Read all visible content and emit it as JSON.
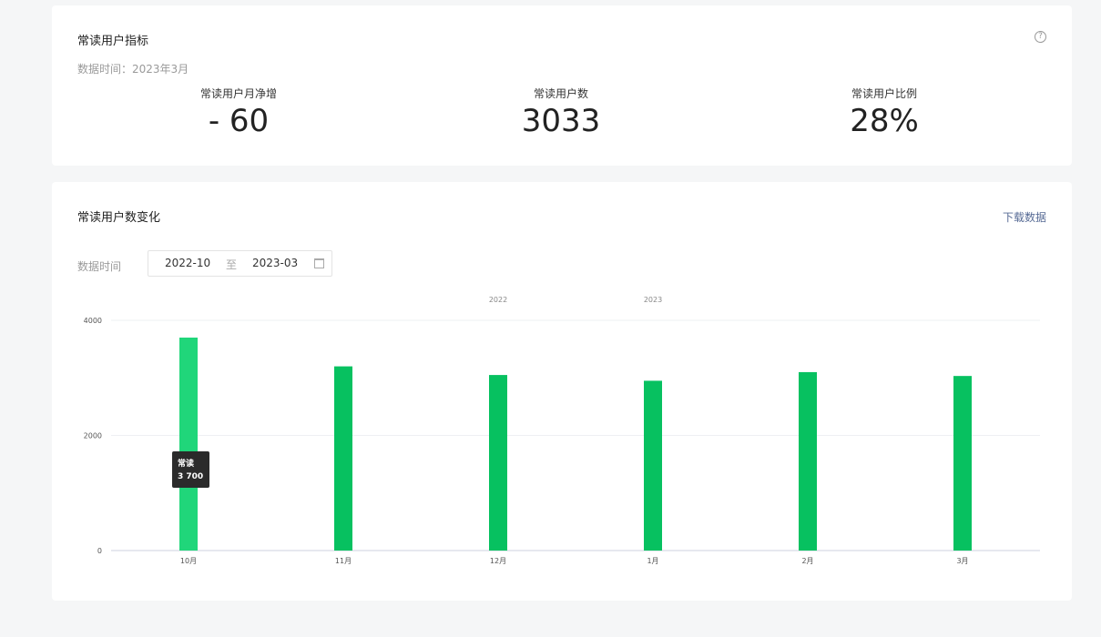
{
  "indicators": {
    "title": "常读用户指标",
    "help_icon": "?",
    "data_time": "数据时间：2023年3月",
    "metrics": [
      {
        "label": "常读用户月净增",
        "value": "- 60"
      },
      {
        "label": "常读用户数",
        "value": "3033"
      },
      {
        "label": "常读用户比例",
        "value": "28%"
      }
    ]
  },
  "trend": {
    "title": "常读用户数变化",
    "download_label": "下载数据",
    "filter_label": "数据时间",
    "range_start": "2022-10",
    "range_separator": "至",
    "range_end": "2023-03",
    "calendar_icon": "calendar-icon"
  },
  "chart_data": {
    "type": "bar",
    "categories": [
      "10月",
      "11月",
      "12月",
      "1月",
      "2月",
      "3月"
    ],
    "year_labels": [
      "2022",
      "2023"
    ],
    "values": [
      3700,
      3200,
      3050,
      2950,
      3100,
      3033
    ],
    "ylim": [
      0,
      4000
    ],
    "yticks": [
      "0",
      "2000",
      "4000"
    ],
    "bar_color": "#07c160",
    "highlight_color": "#20d67a",
    "tooltip": {
      "series": "常读",
      "value": "3 700"
    }
  }
}
